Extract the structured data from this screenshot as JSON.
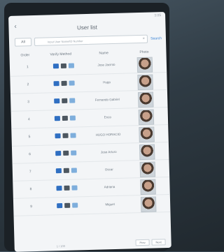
{
  "status_text": "3:05",
  "header": {
    "title": "User list",
    "back_icon": "chevron-left-icon"
  },
  "search": {
    "scope_label": "All",
    "placeholder": "Input User Name/ID Number",
    "button_label": "Search"
  },
  "table": {
    "columns": [
      "Order",
      "Verify Method",
      "Name",
      "Photo"
    ],
    "rows": [
      {
        "order": "1",
        "name": "Jose Jacinto"
      },
      {
        "order": "2",
        "name": "Hugo"
      },
      {
        "order": "3",
        "name": "Fernando Gabriel"
      },
      {
        "order": "4",
        "name": "Enzo"
      },
      {
        "order": "5",
        "name": "HUGO HORACIO"
      },
      {
        "order": "6",
        "name": "Jose Arturo"
      },
      {
        "order": "7",
        "name": "Oscar"
      },
      {
        "order": "8",
        "name": "Adriana"
      },
      {
        "order": "9",
        "name": "Miguel"
      }
    ]
  },
  "pager": {
    "text": "1 / 100",
    "prev": "Prev",
    "next": "Next"
  },
  "colors": {
    "face": "#2f6fc2",
    "card": "#4d5760",
    "password": "#7eaedc",
    "accent": "#3a84d6"
  }
}
